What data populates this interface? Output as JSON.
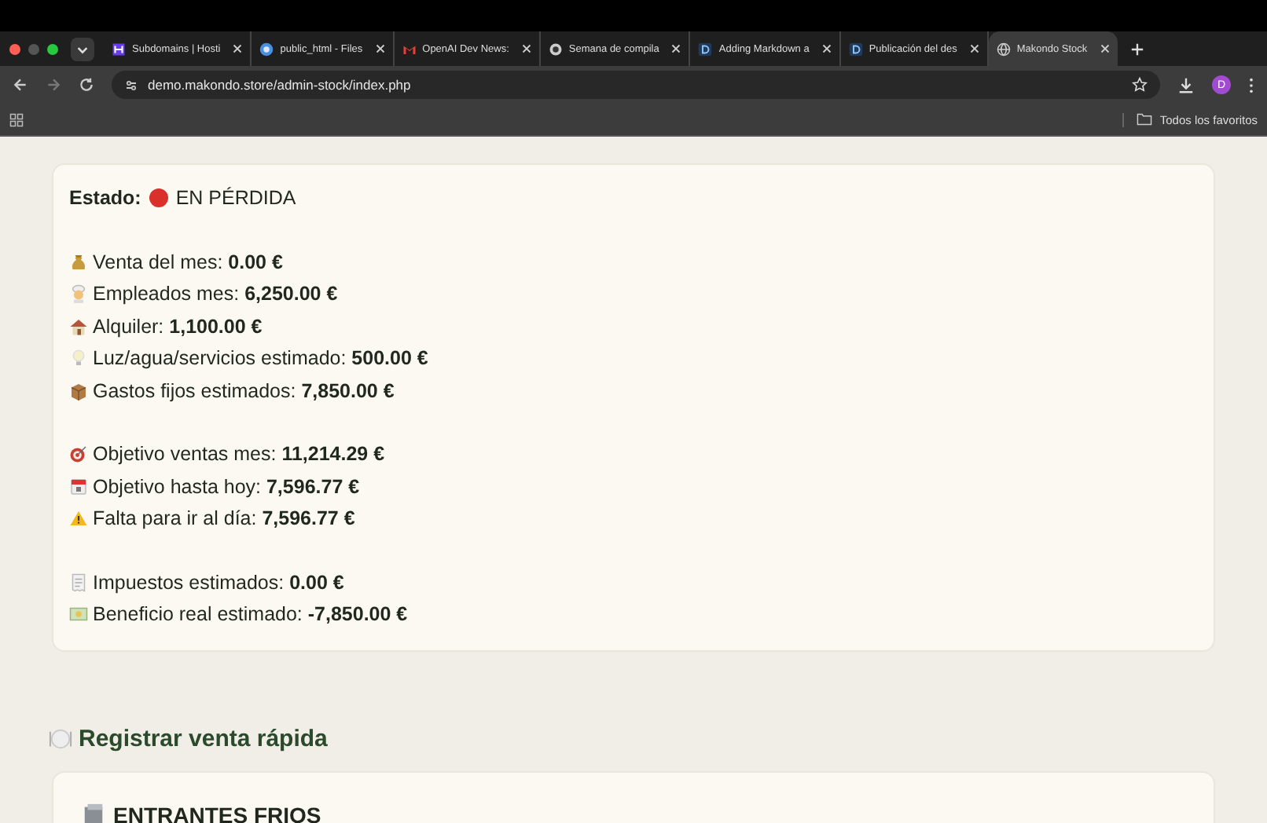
{
  "browser": {
    "tabs": [
      {
        "title": "Subdomains | Hosti",
        "selected": false
      },
      {
        "title": "public_html - Files",
        "selected": false
      },
      {
        "title": "OpenAI Dev News:",
        "selected": false
      },
      {
        "title": "Semana de compila",
        "selected": false
      },
      {
        "title": "Adding Markdown a",
        "selected": false
      },
      {
        "title": "Publicación del des",
        "selected": false
      },
      {
        "title": "Makondo Stock",
        "selected": true
      }
    ],
    "url": "demo.makondo.store/admin-stock/index.php",
    "profile_initial": "D",
    "bookmarks_folder": "Todos los favoritos"
  },
  "summary": {
    "status": {
      "label": "Estado:",
      "value": "EN PÉRDIDA",
      "color": "#d9302c"
    },
    "groups": [
      [
        {
          "label": "Venta del mes:",
          "value": "0.00 €"
        },
        {
          "label": "Empleados mes:",
          "value": "6,250.00 €"
        },
        {
          "label": "Alquiler:",
          "value": "1,100.00 €"
        },
        {
          "label": "Luz/agua/servicios estimado:",
          "value": "500.00 €"
        },
        {
          "label": "Gastos fijos estimados:",
          "value": "7,850.00 €"
        }
      ],
      [
        {
          "label": "Objetivo ventas mes:",
          "value": "11,214.29 €"
        },
        {
          "label": "Objetivo hasta hoy:",
          "value": "7,596.77 €"
        },
        {
          "label": "Falta para ir al día:",
          "value": "7,596.77 €"
        }
      ],
      [
        {
          "label": "Impuestos estimados:",
          "value": "0.00 €"
        },
        {
          "label": "Beneficio real estimado:",
          "value": "-7,850.00 €"
        }
      ]
    ]
  },
  "quick_sale": {
    "title": "Registrar venta rápida",
    "category": "ENTRANTES FRIOS"
  }
}
